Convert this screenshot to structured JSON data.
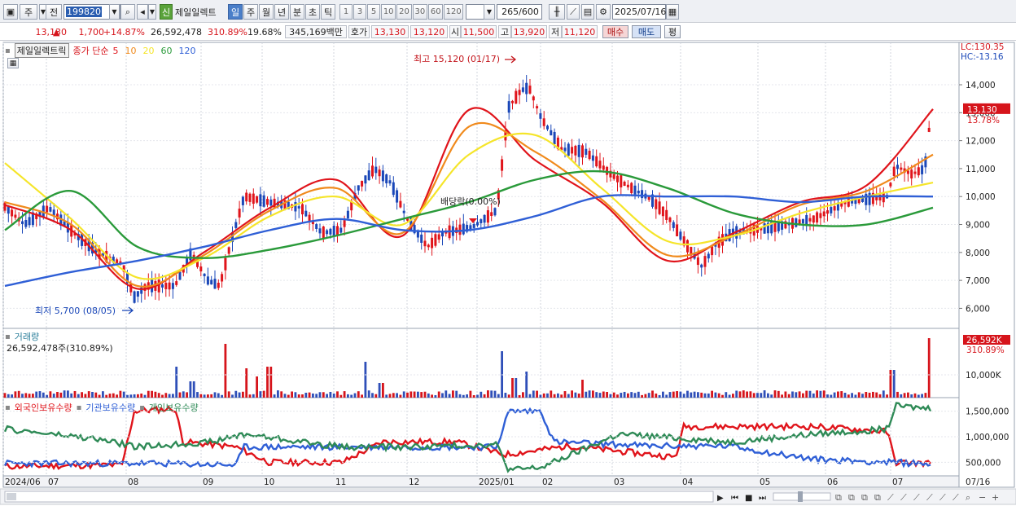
{
  "toolbar": {
    "type_label": "주",
    "prev_label": "전",
    "stock_code": "199820",
    "shin_label": "신",
    "stock_name": "제일일렉트",
    "period_tabs": [
      "일",
      "주",
      "월",
      "년",
      "분",
      "초",
      "틱"
    ],
    "active_period": "일",
    "intervals": [
      "1",
      "3",
      "5",
      "10",
      "20",
      "30",
      "60",
      "120"
    ],
    "count_value": "265",
    "count_total": "/600",
    "date_value": "2025/07/16"
  },
  "quote": {
    "price": "13,130",
    "change": "1,700",
    "change_pct": "+14.87%",
    "volume": "26,592,478",
    "volume_ratio": "310.89%",
    "turnover": "19.68%",
    "amount": "345,169백만",
    "hoga_label": "호가",
    "ask": "13,130",
    "bid": "13,120",
    "open_label": "시",
    "open": "11,500",
    "high_label": "고",
    "high": "13,920",
    "low_label": "저",
    "low": "11,120",
    "buy_label": "매수",
    "sell_label": "매도",
    "eval_label": "평"
  },
  "price_panel": {
    "stock_name": "제일일렉트릭",
    "ma_label": "종가 단순",
    "ma_periods": [
      "5",
      "10",
      "20",
      "60",
      "120"
    ],
    "ma_colors": [
      "#e0141b",
      "#f08a1c",
      "#f5e52a",
      "#2a9a3a",
      "#2f5fd6"
    ],
    "lc_label": "LC:130.35",
    "hc_label": "HC:-13.16",
    "current_price_tag": "13,130",
    "current_pct": "13.78%",
    "max_annotation": "최고 15,120 (01/17)",
    "min_annotation": "최저 5,700 (08/05)",
    "dividend_annotation": "배당락(0.00%)",
    "y_ticks": [
      "14,000",
      "13,000",
      "12,000",
      "11,000",
      "10,000",
      "9,000",
      "8,000",
      "7,000",
      "6,000"
    ]
  },
  "volume_panel": {
    "title": "거래량",
    "value_label": "26,592,478주(310.89%)",
    "tag_value": "26,592K",
    "tag_pct": "310.89%",
    "y_ticks": [
      "10,000K"
    ]
  },
  "holding_panel": {
    "series": [
      "외국인보유수량",
      "기관보유수량",
      "개인보유수량"
    ],
    "colors": [
      "#e0141b",
      "#2f5fd6",
      "#2e8a56"
    ],
    "y_ticks": [
      "1,500,000",
      "1,000,000",
      "500,000"
    ]
  },
  "x_axis": {
    "labels": [
      "2024/06",
      "07",
      "08",
      "09",
      "10",
      "11",
      "12",
      "2025/01",
      "02",
      "03",
      "04",
      "05",
      "06",
      "07"
    ],
    "right_label": "07/16"
  },
  "chart_data": {
    "type": "line",
    "title": "제일일렉트릭",
    "ylim": [
      5400,
      15400
    ],
    "x": [
      "2024/06",
      "07",
      "08",
      "09",
      "10",
      "11",
      "12",
      "2025/01",
      "02",
      "03",
      "04",
      "05",
      "06",
      "07",
      "07/16"
    ],
    "series": [
      {
        "name": "5",
        "values": [
          9700,
          8800,
          6700,
          8000,
          9600,
          10600,
          8600,
          13100,
          11300,
          9800,
          7700,
          8700,
          9800,
          10400,
          13130
        ]
      },
      {
        "name": "10",
        "values": [
          9800,
          9000,
          6800,
          7900,
          9500,
          10300,
          8700,
          12500,
          11600,
          9900,
          7900,
          8600,
          9700,
          10200,
          11500
        ]
      },
      {
        "name": "20",
        "values": [
          11200,
          9200,
          7100,
          7800,
          9300,
          10000,
          9000,
          11500,
          12200,
          10300,
          8400,
          8600,
          9400,
          10000,
          10500
        ]
      },
      {
        "name": "60",
        "values": [
          8800,
          10200,
          8200,
          7800,
          8100,
          8600,
          9200,
          9800,
          10600,
          10900,
          10300,
          9400,
          9000,
          9000,
          9600
        ]
      },
      {
        "name": "120",
        "values": [
          6800,
          7300,
          7700,
          8200,
          8800,
          9200,
          8800,
          8800,
          9300,
          10000,
          10000,
          10000,
          9800,
          10000,
          10000
        ]
      }
    ]
  }
}
